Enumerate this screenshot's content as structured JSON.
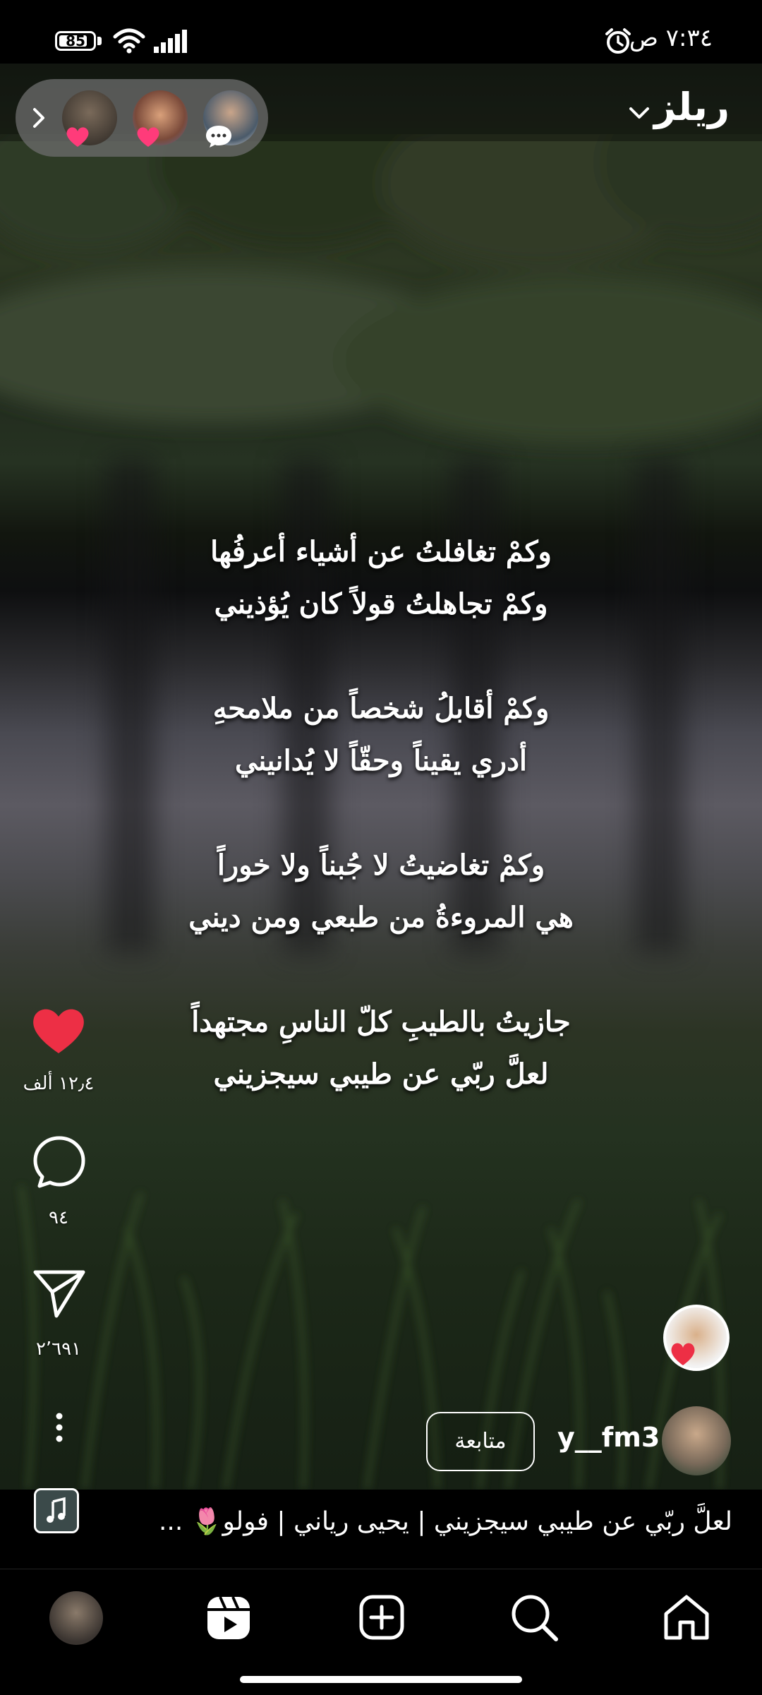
{
  "status_bar": {
    "battery_level": "85",
    "battery_fraction": 0.85,
    "time": "٧:٣٤ ص"
  },
  "header": {
    "title": "ريلز",
    "friend_avatars": [
      "friend-1",
      "friend-2",
      "friend-3"
    ]
  },
  "poem": {
    "lines": [
      "وكمْ تغافلتُ عن أشياء أعرفُها",
      "وكمْ تجاهلتُ قولاً كان يُؤذيني",
      "",
      "وكمْ أقابلُ شخصاً من ملامحهِ",
      "أدري يقيناً وحقّاً لا يُدانيني",
      "",
      "وكمْ تغاضيتُ لا جُبناً ولا خوراً",
      "هي المروءةُ من طبعي ومن ديني",
      "",
      "جازيتُ بالطيبِ كلّ الناسِ مجتهداً",
      "لعلَّ ربّي عن طيبي سيجزيني"
    ]
  },
  "actions": {
    "likes": "١٢٫٤ ألف",
    "comments": "٩٤",
    "shares": "٢٬٦٩١"
  },
  "post": {
    "username": "y__fm3",
    "follow_label": "متابعة",
    "caption": "لعلَّ ربّي عن طيبي سيجزيني | يحيى رياني | فولو🌷 ..."
  },
  "colors": {
    "like": "#ed2f45",
    "background": "#000000"
  },
  "nav": {
    "items": [
      "home-icon",
      "search-icon",
      "create-icon",
      "reels-icon",
      "profile-avatar"
    ]
  }
}
